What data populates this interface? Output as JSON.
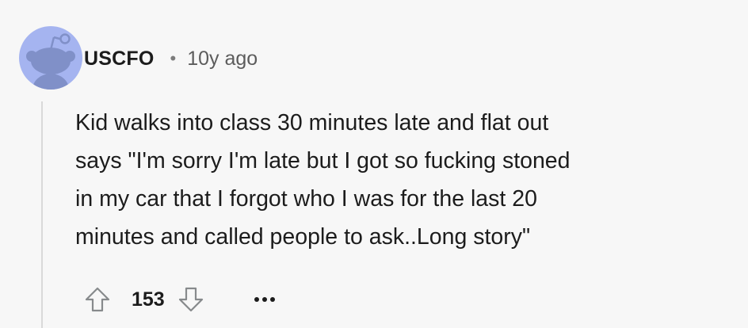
{
  "comment": {
    "author": "USCFO",
    "separator": "•",
    "age": "10y ago",
    "body": "Kid walks into class 30 minutes late and flat out\nsays \"I'm sorry I'm late but I got so fucking stoned\nin my car that I forgot who I was for the last 20\nminutes and called people to ask..Long story\"",
    "score": "153"
  },
  "avatar": {
    "background": "#a5b4f0",
    "figure_color": "#8090c8",
    "icon": "snoo-avatar-icon"
  },
  "actions": {
    "upvote_icon": "upvote-arrow-icon",
    "downvote_icon": "downvote-arrow-icon",
    "more_icon": "more-options-icon"
  }
}
